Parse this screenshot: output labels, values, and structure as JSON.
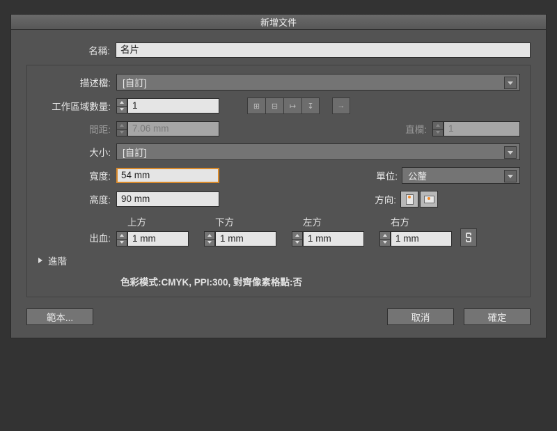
{
  "title": "新增文件",
  "name": {
    "label": "名稱:",
    "value": "名片"
  },
  "profile": {
    "label": "描述檔:",
    "value": "[自訂]"
  },
  "artboards": {
    "label": "工作區域數量:",
    "value": "1"
  },
  "spacing": {
    "label": "間距:",
    "value": "7.06 mm"
  },
  "columns": {
    "label": "直欄:",
    "value": "1"
  },
  "size": {
    "label": "大小:",
    "value": "[自訂]"
  },
  "width": {
    "label": "寬度:",
    "value": "54 mm"
  },
  "height": {
    "label": "高度:",
    "value": "90 mm"
  },
  "units": {
    "label": "單位:",
    "value": "公釐"
  },
  "orientation": {
    "label": "方向:"
  },
  "bleed": {
    "label": "出血:",
    "top": {
      "hdr": "上方",
      "value": "1 mm"
    },
    "bottom": {
      "hdr": "下方",
      "value": "1 mm"
    },
    "left": {
      "hdr": "左方",
      "value": "1 mm"
    },
    "right": {
      "hdr": "右方",
      "value": "1 mm"
    }
  },
  "advanced": {
    "label": "進階"
  },
  "summary": "色彩模式:CMYK, PPI:300, 對齊像素格點:否",
  "buttons": {
    "templates": "範本...",
    "cancel": "取消",
    "ok": "確定"
  }
}
